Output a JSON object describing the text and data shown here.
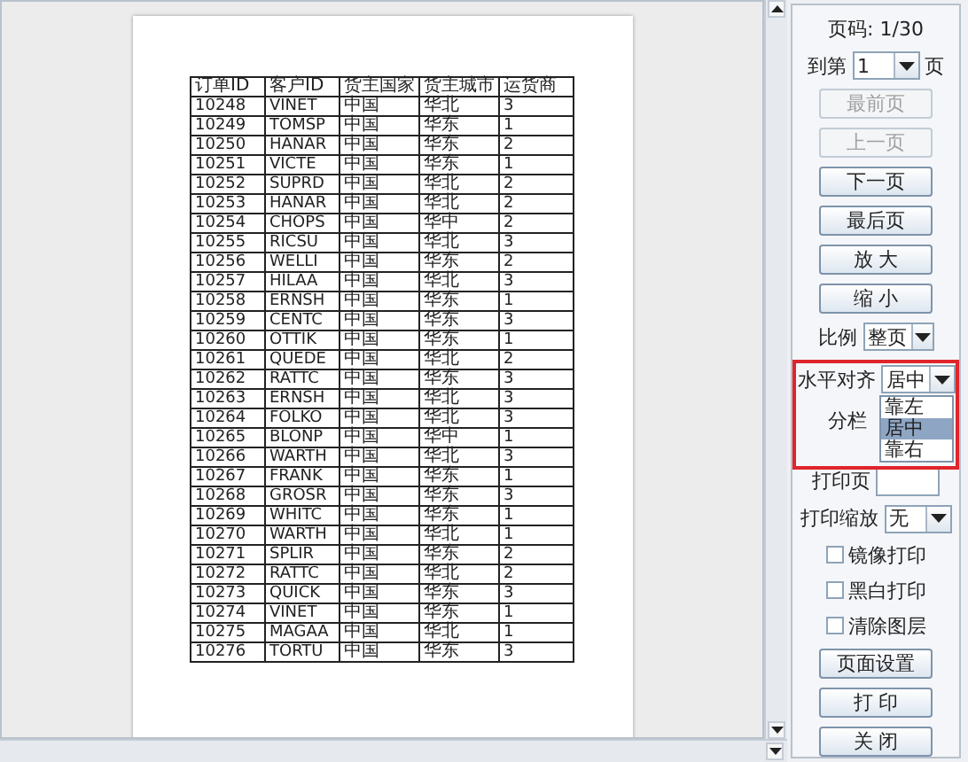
{
  "preview": {
    "columns": [
      "订单ID",
      "客户ID",
      "货主国家",
      "货主城市",
      "运货商"
    ],
    "rows": [
      [
        "10248",
        "VINET",
        "中国",
        "华北",
        "3"
      ],
      [
        "10249",
        "TOMSP",
        "中国",
        "华东",
        "1"
      ],
      [
        "10250",
        "HANAR",
        "中国",
        "华东",
        "2"
      ],
      [
        "10251",
        "VICTE",
        "中国",
        "华东",
        "1"
      ],
      [
        "10252",
        "SUPRD",
        "中国",
        "华北",
        "2"
      ],
      [
        "10253",
        "HANAR",
        "中国",
        "华北",
        "2"
      ],
      [
        "10254",
        "CHOPS",
        "中国",
        "华中",
        "2"
      ],
      [
        "10255",
        "RICSU",
        "中国",
        "华北",
        "3"
      ],
      [
        "10256",
        "WELLI",
        "中国",
        "华东",
        "2"
      ],
      [
        "10257",
        "HILAA",
        "中国",
        "华北",
        "3"
      ],
      [
        "10258",
        "ERNSH",
        "中国",
        "华东",
        "1"
      ],
      [
        "10259",
        "CENTC",
        "中国",
        "华东",
        "3"
      ],
      [
        "10260",
        "OTTIK",
        "中国",
        "华东",
        "1"
      ],
      [
        "10261",
        "QUEDE",
        "中国",
        "华北",
        "2"
      ],
      [
        "10262",
        "RATTC",
        "中国",
        "华东",
        "3"
      ],
      [
        "10263",
        "ERNSH",
        "中国",
        "华北",
        "3"
      ],
      [
        "10264",
        "FOLKO",
        "中国",
        "华北",
        "3"
      ],
      [
        "10265",
        "BLONP",
        "中国",
        "华中",
        "1"
      ],
      [
        "10266",
        "WARTH",
        "中国",
        "华北",
        "3"
      ],
      [
        "10267",
        "FRANK",
        "中国",
        "华东",
        "1"
      ],
      [
        "10268",
        "GROSR",
        "中国",
        "华东",
        "3"
      ],
      [
        "10269",
        "WHITC",
        "中国",
        "华东",
        "1"
      ],
      [
        "10270",
        "WARTH",
        "中国",
        "华北",
        "1"
      ],
      [
        "10271",
        "SPLIR",
        "中国",
        "华东",
        "2"
      ],
      [
        "10272",
        "RATTC",
        "中国",
        "华北",
        "2"
      ],
      [
        "10273",
        "QUICK",
        "中国",
        "华东",
        "3"
      ],
      [
        "10274",
        "VINET",
        "中国",
        "华东",
        "1"
      ],
      [
        "10275",
        "MAGAA",
        "中国",
        "华北",
        "1"
      ],
      [
        "10276",
        "TORTU",
        "中国",
        "华东",
        "3"
      ]
    ]
  },
  "page_label": "页码: 1/30",
  "goto": {
    "prefix": "到第",
    "value": "1",
    "suffix": "页"
  },
  "nav_buttons": [
    {
      "label": "最前页",
      "disabled": true
    },
    {
      "label": "上一页",
      "disabled": true
    },
    {
      "label": "下一页",
      "disabled": false
    },
    {
      "label": "最后页",
      "disabled": false
    },
    {
      "label": "放 大",
      "disabled": false
    },
    {
      "label": "缩 小",
      "disabled": false
    }
  ],
  "scale": {
    "label": "比例",
    "value": "整页"
  },
  "halign": {
    "label": "水平对齐",
    "value": "居中",
    "options": [
      {
        "label": "靠左",
        "selected": false
      },
      {
        "label": "居中",
        "selected": true
      },
      {
        "label": "靠右",
        "selected": false
      }
    ]
  },
  "split": {
    "label": "分栏"
  },
  "print_pages": {
    "label": "打印页"
  },
  "print_scale": {
    "label": "打印缩放",
    "value": "无"
  },
  "checkboxes": [
    {
      "label": "镜像打印",
      "checked": false
    },
    {
      "label": "黑白打印",
      "checked": false
    },
    {
      "label": "清除图层",
      "checked": false
    }
  ],
  "action_buttons": [
    "页面设置",
    "打 印",
    "关 闭"
  ]
}
